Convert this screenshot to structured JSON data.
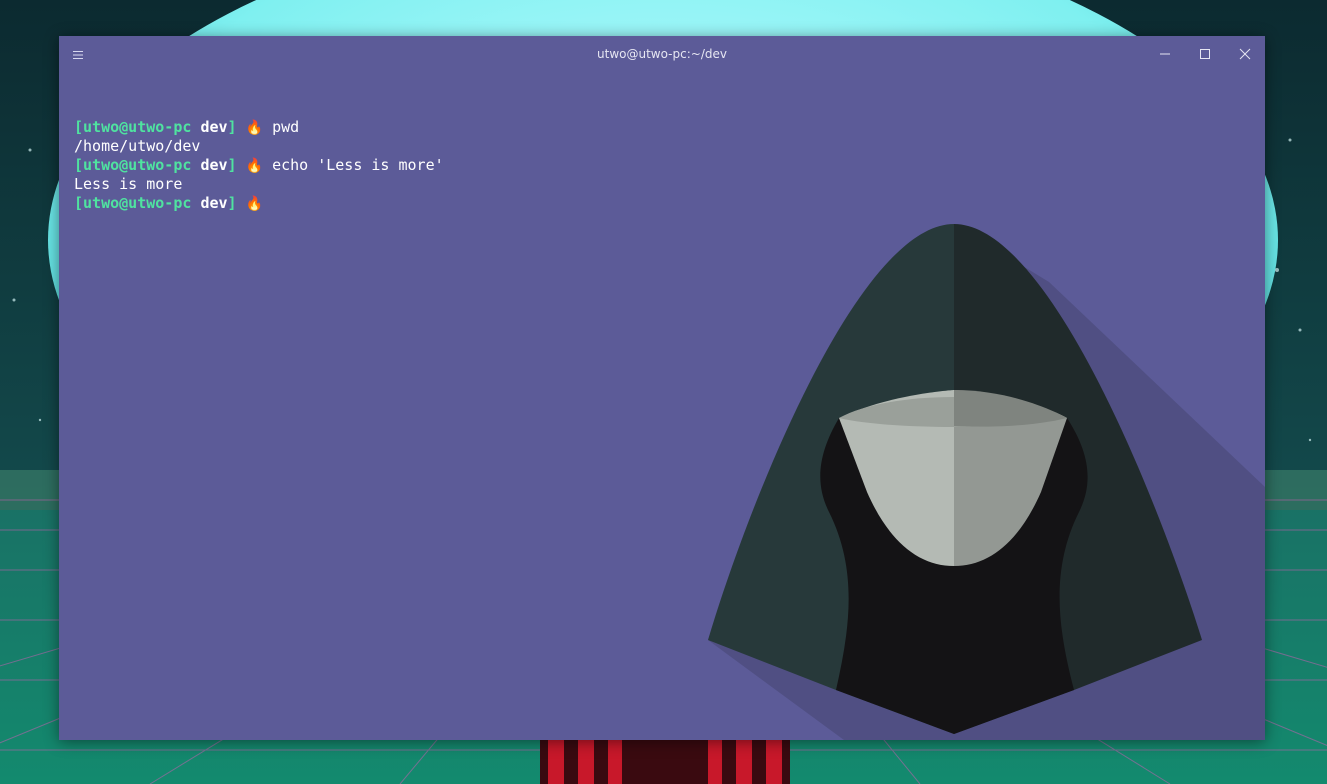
{
  "window": {
    "title": "utwo@utwo-pc:~/dev"
  },
  "colors": {
    "terminal_background": "#5c5b98",
    "prompt_user": "#4fe3a0",
    "prompt_dir": "#ffffff",
    "output_text": "#ffffff"
  },
  "icons": {
    "menu": "hamburger-icon",
    "minimize": "minimize-icon",
    "maximize": "maximize-icon",
    "close": "close-icon",
    "prompt_symbol": "flame-icon"
  },
  "prompt": {
    "user_host": "[utwo@utwo-pc",
    "dir": "dev",
    "close_bracket": "]",
    "symbol": "🔥"
  },
  "terminal": {
    "lines": [
      {
        "type": "command",
        "command": "pwd"
      },
      {
        "type": "output",
        "text": "/home/utwo/dev"
      },
      {
        "type": "command",
        "command": "echo 'Less is more'"
      },
      {
        "type": "output",
        "text": "Less is more"
      },
      {
        "type": "command",
        "command": ""
      }
    ]
  }
}
